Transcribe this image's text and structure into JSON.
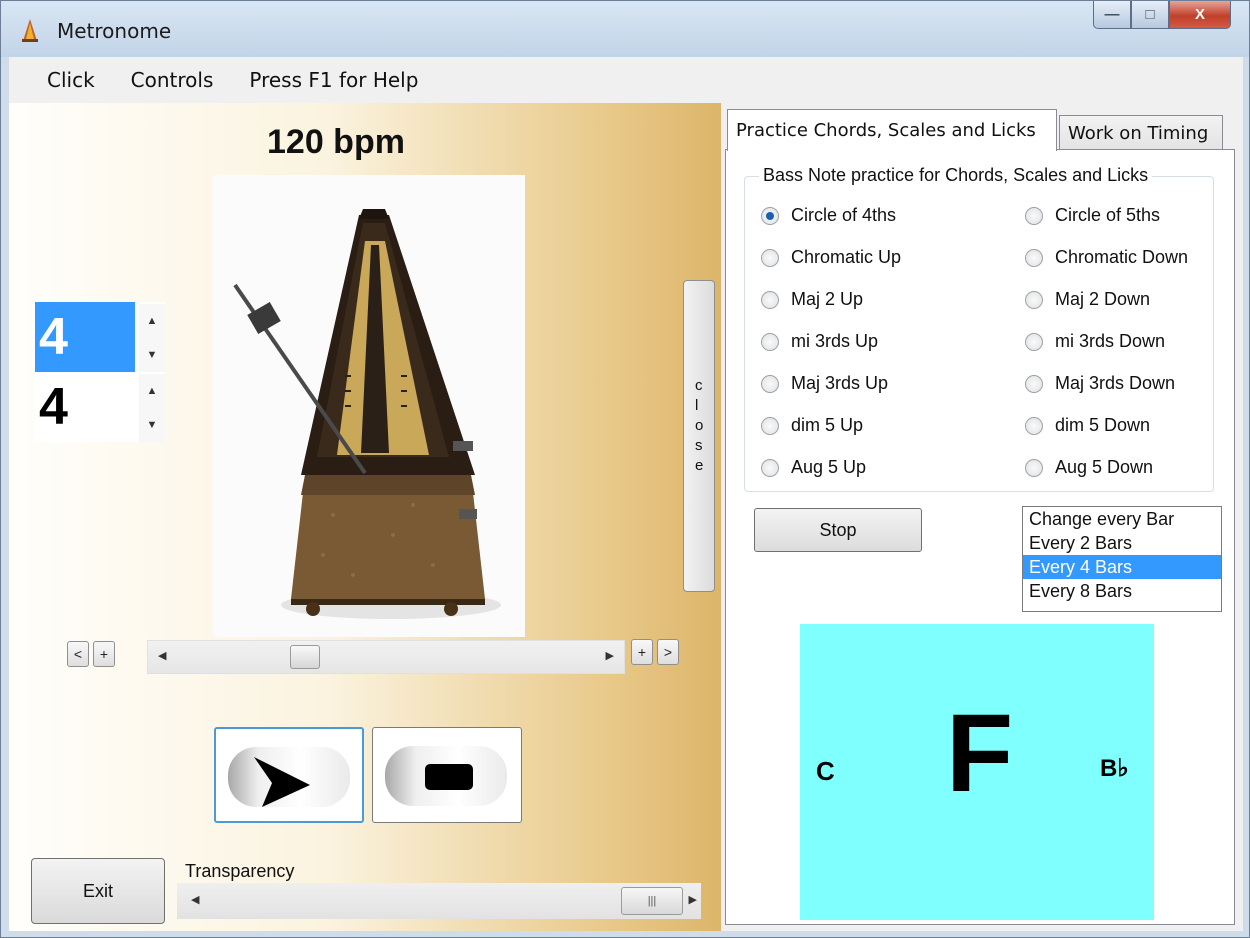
{
  "window": {
    "title": "Metronome",
    "buttons": {
      "minimize": "—",
      "maximize": "□",
      "close": "X"
    }
  },
  "menu": [
    "Click",
    "Controls",
    "Press F1 for Help"
  ],
  "left": {
    "bpm": "120 bpm",
    "time_signature": {
      "top": "4",
      "bottom": "4"
    },
    "close_label": [
      "c",
      "l",
      "o",
      "s",
      "e"
    ],
    "slider_buttons": {
      "left_prev": "<",
      "left_plus": "+",
      "right_plus": "+",
      "right_next": ">"
    },
    "exit_label": "Exit",
    "transparency_label": "Transparency"
  },
  "right": {
    "tabs": [
      "Practice Chords, Scales and Licks",
      "Work on Timing"
    ],
    "group_label": "Bass Note practice for Chords, Scales and Licks",
    "radios_left": [
      "Circle of 4ths",
      "Chromatic Up",
      "Maj 2 Up",
      "mi 3rds Up",
      "Maj 3rds Up",
      "dim 5 Up",
      "Aug 5 Up"
    ],
    "radios_right": [
      "Circle of 5ths",
      "Chromatic Down",
      "Maj 2 Down",
      "mi 3rds Down",
      "Maj 3rds Down",
      "dim 5 Down",
      "Aug 5 Down"
    ],
    "selected_radio": "Circle of 4ths",
    "stop_label": "Stop",
    "list_items": [
      "Change every Bar",
      "Every 2 Bars",
      "Every 4 Bars",
      "Every 8 Bars"
    ],
    "selected_list_item": "Every 4 Bars",
    "chord": {
      "previous": "C",
      "current": "F",
      "next": "B♭",
      "background": "#80ffff"
    }
  },
  "colors": {
    "selection": "#3399ff",
    "chord_bg": "#80ffff"
  }
}
